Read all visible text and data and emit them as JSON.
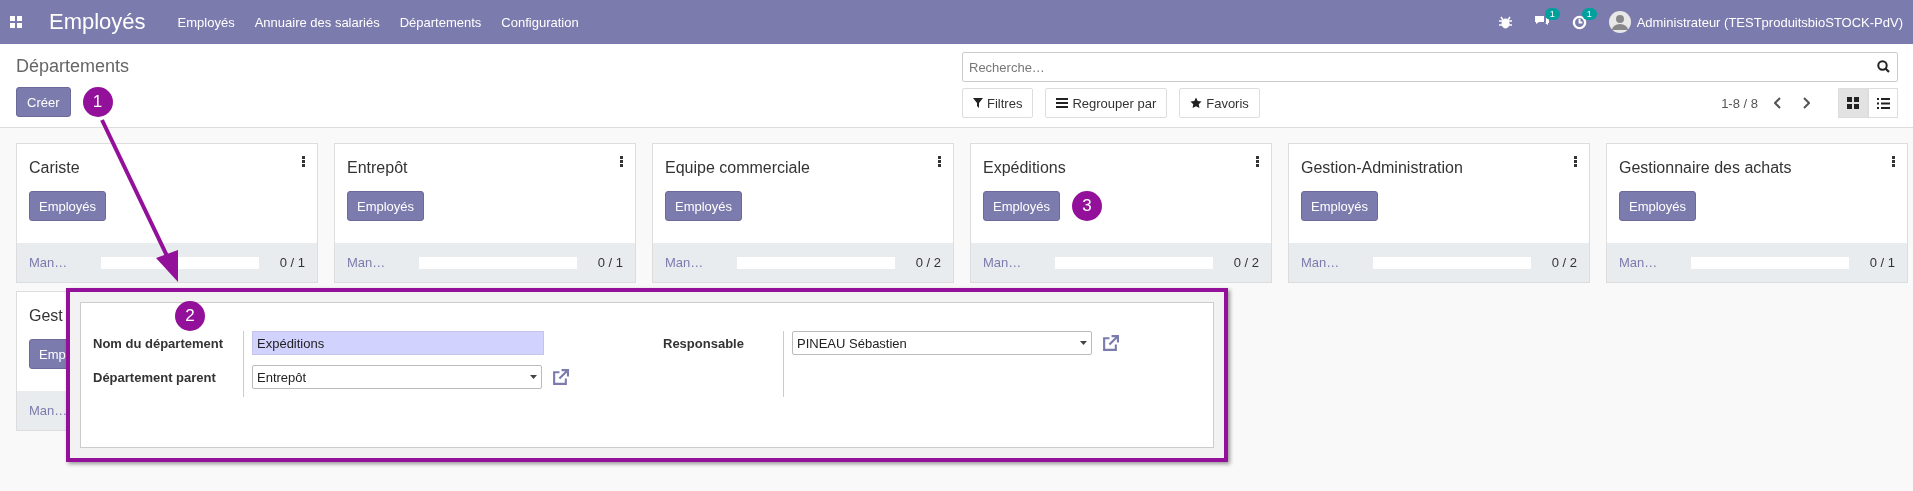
{
  "navbar": {
    "app_title": "Employés",
    "menu": [
      "Employés",
      "Annuaire des salariés",
      "Départements",
      "Configuration"
    ],
    "notifications": [
      {
        "kind": "messages",
        "count": "1"
      },
      {
        "kind": "activities",
        "count": "1"
      }
    ],
    "user": "Administrateur (TESTproduitsbioSTOCK-PdV)"
  },
  "control_panel": {
    "breadcrumb": "Départements",
    "create_button": "Créer",
    "callout": "1",
    "search": {
      "placeholder": "Recherche…"
    },
    "search_buttons": [
      {
        "kind": "filter",
        "label": "Filtres"
      },
      {
        "kind": "group",
        "label": "Regrouper par"
      },
      {
        "kind": "favorite",
        "label": "Favoris"
      }
    ],
    "pager": "1-8 / 8",
    "views": [
      {
        "kind": "kanban",
        "selected": true
      },
      {
        "kind": "list",
        "selected": false
      }
    ]
  },
  "cards": [
    {
      "kind": "full",
      "title": "Cariste",
      "button": "Employés",
      "manager": "Man…",
      "count": "0 / 1",
      "level": 0
    },
    {
      "kind": "full",
      "title": "Entrepôt",
      "button": "Employés",
      "manager": "Man…",
      "count": "0 / 1",
      "level": 0
    },
    {
      "kind": "full",
      "title": "Equipe commerciale",
      "button": "Employés",
      "manager": "Man…",
      "count": "0 / 2",
      "level": 0
    },
    {
      "kind": "full",
      "title": "Expéditions",
      "button": "Employés",
      "manager": "Man…",
      "count": "0 / 2",
      "level": 0,
      "callout": "3"
    },
    {
      "kind": "full",
      "title": "Gestion-Administration",
      "button": "Employés",
      "manager": "Man…",
      "count": "0 / 2",
      "level": 0
    },
    {
      "kind": "full",
      "title": "Gestionnaire des achats",
      "button": "Employés",
      "manager": "Man…",
      "count": "0 / 1",
      "level": 0
    },
    {
      "kind": "partial",
      "title": "Gest",
      "button": "Emp",
      "manager": "Man…"
    }
  ],
  "form": {
    "callout": "2",
    "fields": [
      {
        "kind": "text",
        "label": "Nom du département",
        "value": "Expéditions"
      },
      {
        "kind": "select",
        "label": "Département parent",
        "value": "Entrepôt"
      }
    ],
    "responsible": {
      "kind": "select",
      "label": "Responsable",
      "value": "PINEAU Sébastien"
    }
  }
}
